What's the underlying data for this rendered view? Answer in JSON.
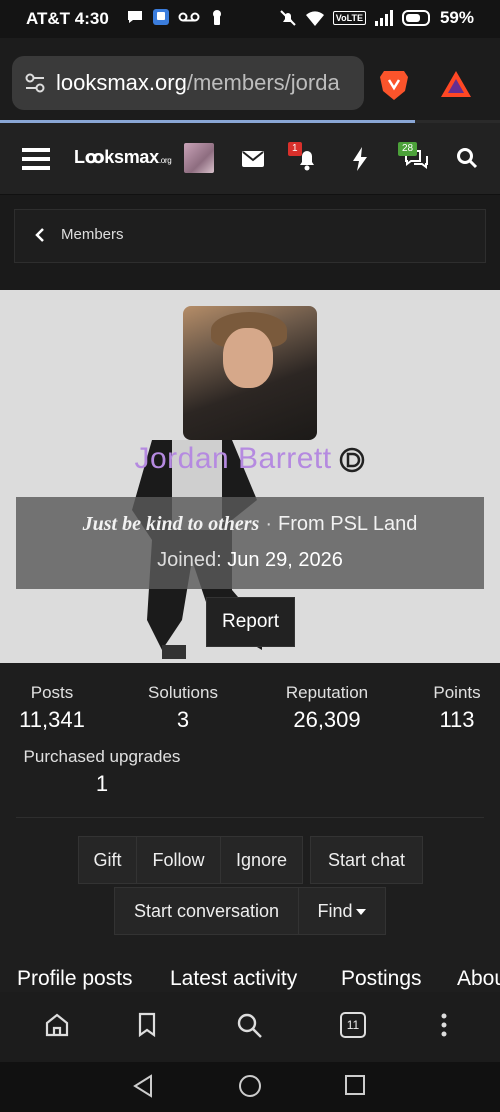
{
  "status_bar": {
    "time": "AT&T 4:30",
    "battery": "59%",
    "icons": [
      "chat-bubble-icon",
      "app-badge-icon",
      "voicemail-icon",
      "lock-keyhole-icon",
      "mute-icon",
      "wifi-icon",
      "volte-icon",
      "signal-icon",
      "battery-icon"
    ],
    "volte_label": "VoLTE"
  },
  "browser": {
    "url_host": "looksmax.org",
    "url_path": "/members/jorda",
    "page_load_progress": 0.83,
    "tab_count": "11"
  },
  "site_nav": {
    "logo_text": "Lꝏksmax",
    "logo_suffix": ".org",
    "alerts_badge": "1",
    "conversations_badge": "28"
  },
  "breadcrumb": {
    "label": "Members"
  },
  "profile": {
    "username": "Jordan Barrett",
    "custom_title": "Just be kind to others",
    "separator": "·",
    "location": "From PSL Land",
    "joined_label": "Joined:",
    "joined_date": "Jun 29, 2026",
    "report_label": "Report"
  },
  "stats": {
    "posts_label": "Posts",
    "posts_value": "11,341",
    "solutions_label": "Solutions",
    "solutions_value": "3",
    "reputation_label": "Reputation",
    "reputation_value": "26,309",
    "points_label": "Points",
    "points_value": "113",
    "upgrades_label": "Purchased upgrades",
    "upgrades_value": "1"
  },
  "actions": {
    "gift": "Gift",
    "follow": "Follow",
    "ignore": "Ignore",
    "start_chat": "Start chat",
    "start_conversation": "Start conversation",
    "find": "Find"
  },
  "tabs": [
    "Profile posts",
    "Latest activity",
    "Postings",
    "About"
  ],
  "colors": {
    "username": "#b58ae0",
    "alert_badge": "#d9302b",
    "conv_badge": "#4ca13a"
  }
}
